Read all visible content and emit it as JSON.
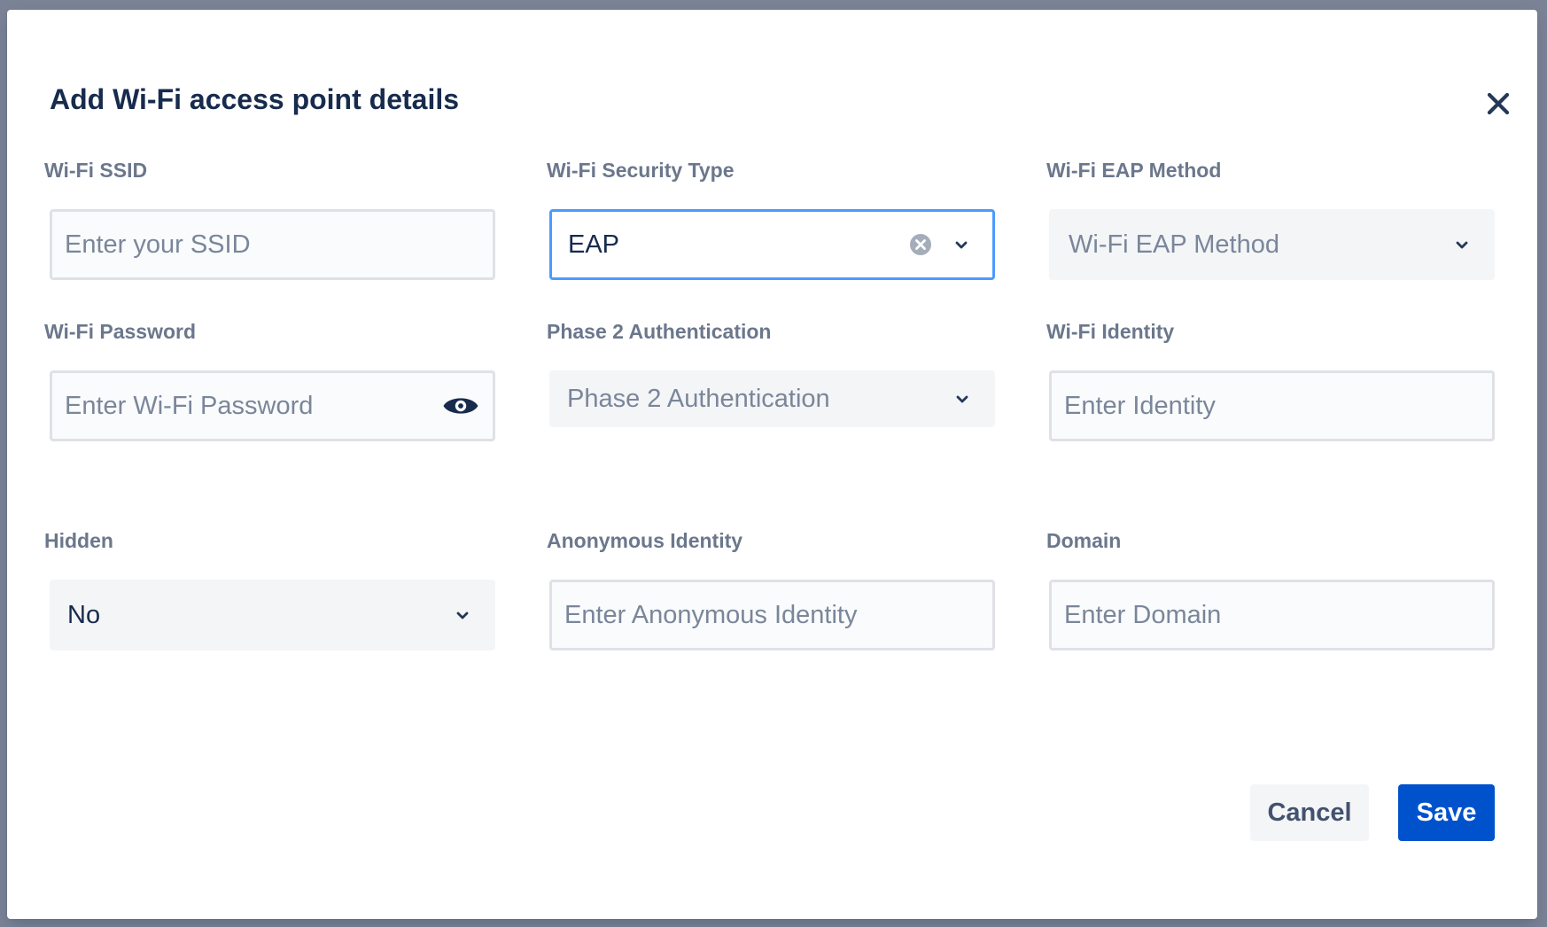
{
  "dialog": {
    "title": "Add Wi-Fi access point details",
    "close_icon": "close-icon"
  },
  "fields": {
    "ssid": {
      "label": "Wi-Fi SSID",
      "placeholder": "Enter your SSID",
      "value": ""
    },
    "security_type": {
      "label": "Wi-Fi Security Type",
      "value": "EAP",
      "clear_icon": "clear-icon",
      "dropdown_icon": "chevron-down-icon"
    },
    "eap_method": {
      "label": "Wi-Fi EAP Method",
      "placeholder": "Wi-Fi EAP Method",
      "dropdown_icon": "chevron-down-icon"
    },
    "password": {
      "label": "Wi-Fi Password",
      "placeholder": "Enter Wi-Fi Password",
      "value": "",
      "reveal_icon": "eye-icon"
    },
    "phase2": {
      "label": "Phase 2 Authentication",
      "placeholder": "Phase 2 Authentication",
      "dropdown_icon": "chevron-down-icon"
    },
    "identity": {
      "label": "Wi-Fi Identity",
      "placeholder": "Enter Identity",
      "value": ""
    },
    "hidden": {
      "label": "Hidden",
      "value": "No",
      "dropdown_icon": "chevron-down-icon"
    },
    "anonymous_identity": {
      "label": "Anonymous Identity",
      "placeholder": "Enter Anonymous Identity",
      "value": ""
    },
    "domain": {
      "label": "Domain",
      "placeholder": "Enter Domain",
      "value": ""
    }
  },
  "actions": {
    "cancel_label": "Cancel",
    "save_label": "Save"
  },
  "colors": {
    "primary": "#0052cc",
    "focus_border": "#4c9aff",
    "text": "#172b4d",
    "label": "#6b778c",
    "placeholder": "#7a869a",
    "overlay": "#7a8295"
  }
}
